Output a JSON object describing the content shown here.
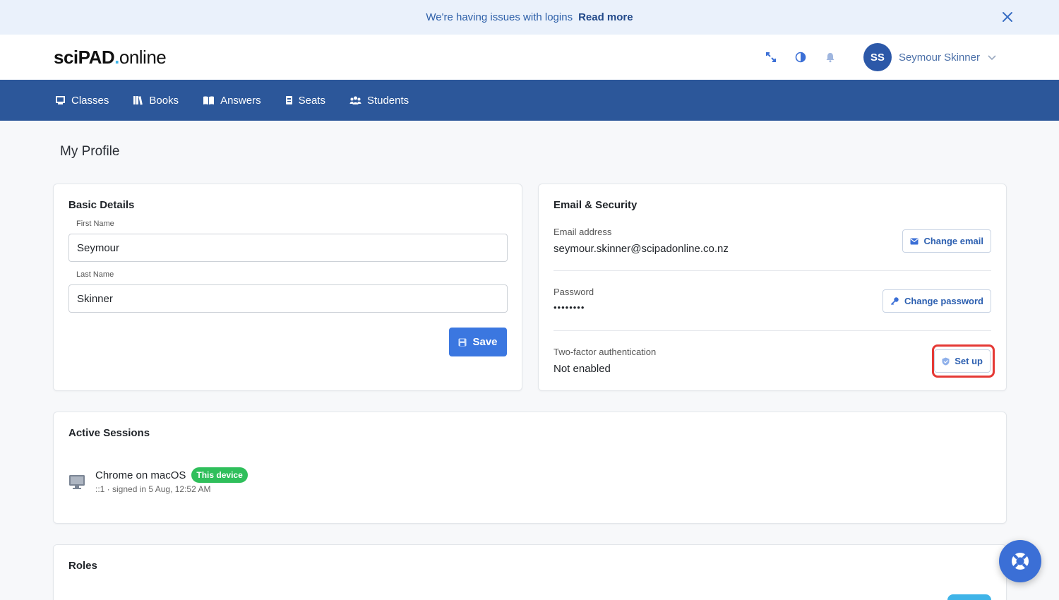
{
  "banner": {
    "message": "We're having issues with logins",
    "link": "Read more"
  },
  "header": {
    "logo": {
      "sci": "sci",
      "pad": "PAD",
      "dot": ".",
      "online": "online"
    },
    "user": {
      "initials": "SS",
      "name": "Seymour Skinner"
    }
  },
  "nav": {
    "items": [
      {
        "label": "Classes",
        "icon": "classes-icon"
      },
      {
        "label": "Books",
        "icon": "books-icon"
      },
      {
        "label": "Answers",
        "icon": "answers-icon"
      },
      {
        "label": "Seats",
        "icon": "seats-icon"
      },
      {
        "label": "Students",
        "icon": "students-icon"
      }
    ]
  },
  "page": {
    "title": "My Profile"
  },
  "basic_details": {
    "title": "Basic Details",
    "first_name_label": "First Name",
    "first_name_value": "Seymour",
    "last_name_label": "Last Name",
    "last_name_value": "Skinner",
    "save_label": "Save"
  },
  "security": {
    "title": "Email & Security",
    "email_label": "Email address",
    "email_value": "seymour.skinner@scipadonline.co.nz",
    "change_email": "Change email",
    "password_label": "Password",
    "password_value": "••••••••",
    "change_password": "Change password",
    "tfa_label": "Two-factor authentication",
    "tfa_value": "Not enabled",
    "setup": "Set up"
  },
  "sessions": {
    "title": "Active Sessions",
    "items": [
      {
        "name": "Chrome on macOS",
        "badge": "This device",
        "meta": "::1 · signed in 5 Aug, 12:52 AM"
      }
    ]
  },
  "roles": {
    "title": "Roles"
  },
  "colors": {
    "brand": "#2c579a",
    "accent": "#3b77e0",
    "success": "#2fbf5b",
    "highlight": "#e53935"
  }
}
